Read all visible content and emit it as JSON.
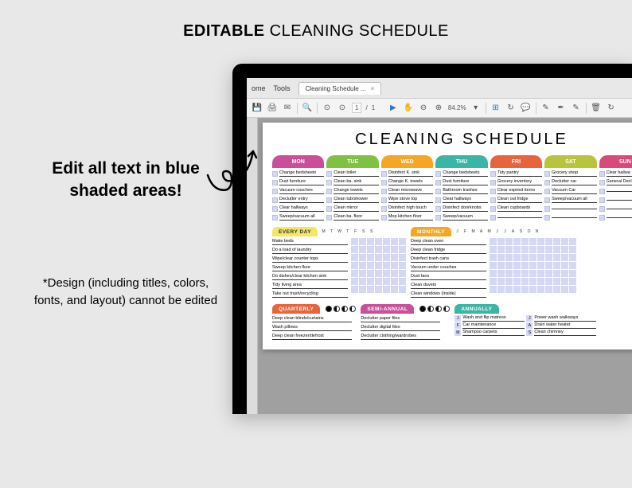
{
  "title": {
    "bold": "EDITABLE",
    "light": " CLEANING SCHEDULE"
  },
  "left": {
    "edit": "Edit all text in blue shaded areas!",
    "design": "*Design (including titles, colors, fonts, and layout) cannot be edited"
  },
  "app": {
    "home": "ome",
    "tools": "Tools",
    "tab": "Cleaning Schedule ...",
    "page_current": "1",
    "page_sep": "/",
    "page_total": "1",
    "zoom": "84.2%"
  },
  "doc": {
    "title": "CLEANING SCHEDULE",
    "days": [
      {
        "name": "MON",
        "color": "#c94f9a",
        "tasks": [
          "Change bedsheets",
          "Dust furniture",
          "Vacuum couches",
          "Declutter entry",
          "Clear hallways",
          "Sweep/vacuum all"
        ]
      },
      {
        "name": "TUE",
        "color": "#7fc243",
        "tasks": [
          "Clean toilet",
          "Clean ba. sink",
          "Change towels",
          "Clean tub/shower",
          "Clean mirror",
          "Clean ba. floor"
        ]
      },
      {
        "name": "WED",
        "color": "#f5a623",
        "tasks": [
          "Disinfect K. sink",
          "Change K. towels",
          "Clean microwave",
          "Wipe stove top",
          "Disinfect high touch",
          "Mop kitchen floor"
        ]
      },
      {
        "name": "THU",
        "color": "#3bb5a5",
        "tasks": [
          "Change bedsheets",
          "Dust furniture",
          "Bathroom trashes",
          "Clear hallways",
          "Disinfect doorknobs",
          "Sweep/vacuum"
        ]
      },
      {
        "name": "FRI",
        "color": "#e8643c",
        "tasks": [
          "Tidy pantry",
          "Grocery inventory",
          "Clear expired items",
          "Clean out fridge",
          "Clean cupboards",
          ""
        ]
      },
      {
        "name": "SAT",
        "color": "#b8c43c",
        "tasks": [
          "Grocery shop",
          "Declutter car",
          "Vacuum Car",
          "Sweep/vacuum all",
          "",
          ""
        ]
      },
      {
        "name": "SUN",
        "color": "#d94a7a",
        "tasks": [
          "Clear hallwa",
          "General Decl",
          "",
          "",
          "",
          ""
        ]
      }
    ],
    "everyday": {
      "label": "EVERY DAY",
      "color": "#f5e663",
      "cols": [
        "M",
        "T",
        "W",
        "T",
        "F",
        "S",
        "S"
      ],
      "tasks": [
        "Make beds",
        "Do a load of laundry",
        "Wipe/clear counter tops",
        "Sweep kitchen floor",
        "Do dishes/clear kitchen sink",
        "Tidy living area",
        "Take out trash/recycling"
      ]
    },
    "monthly": {
      "label": "MONTHLY",
      "color": "#f5a623",
      "cols": [
        "J",
        "F",
        "M",
        "A",
        "M",
        "J",
        "J",
        "A",
        "S",
        "O",
        "N"
      ],
      "tasks": [
        "Deep clean oven",
        "Deep clean fridge",
        "Disinfect trash cans",
        "Vacuum under couches",
        "Dust fans",
        "Clean duvets",
        "Clean windows (inside)"
      ]
    },
    "quarterly": {
      "label": "QUARTERLY",
      "color": "#e8643c",
      "tasks": [
        "Deep clean blinds/curtains",
        "Wash pillows",
        "Deep clean freezer/defrost"
      ]
    },
    "semiannual": {
      "label": "SEMI-ANNUAL",
      "color": "#c94f9a",
      "tasks": [
        "Declutter paper files",
        "Declutter digital files",
        "Declutter clothing/wardrobes"
      ]
    },
    "annually": {
      "label": "ANNUALLY",
      "color": "#3bb5a5",
      "items": [
        {
          "m": "J",
          "task": "Wash and flip matress",
          "m2": "J",
          "task2": "Power wash walkways"
        },
        {
          "m": "F",
          "task": "Car maintenance",
          "m2": "A",
          "task2": "Drain water heater"
        },
        {
          "m": "M",
          "task": "Shampoo carpets",
          "m2": "S",
          "task2": "Clean chimney"
        }
      ]
    }
  }
}
